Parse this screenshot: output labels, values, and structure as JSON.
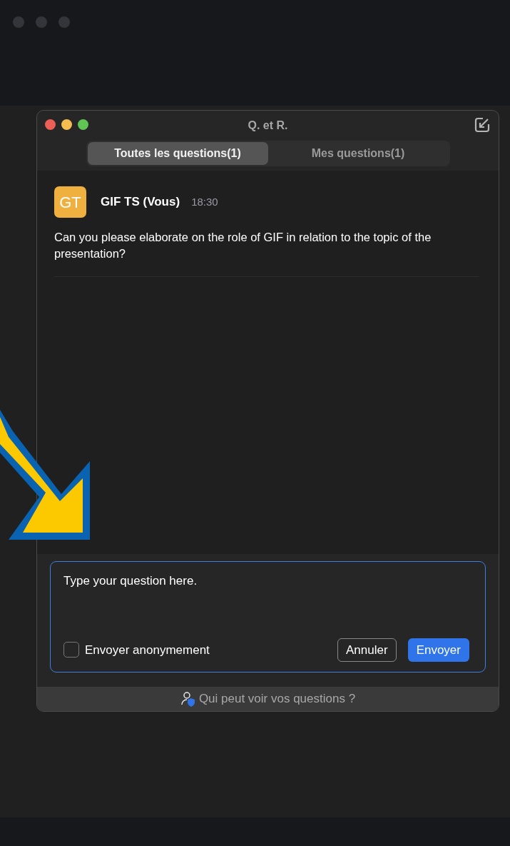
{
  "window": {
    "title": "Q. et R."
  },
  "tabs": [
    {
      "label": "Toutes les questions(1)",
      "selected": true
    },
    {
      "label": "Mes questions(1)",
      "selected": false
    }
  ],
  "questions": [
    {
      "initials": "GT",
      "author": "GIF TS (Vous)",
      "time": "18:30",
      "text": "Can you please elaborate on the role of GIF in relation to the topic of the presentation?"
    }
  ],
  "composer": {
    "value": "Type your question here.",
    "anonymous": {
      "label": "Envoyer anonymement",
      "checked": false
    },
    "cancel": "Annuler",
    "send": "Envoyer"
  },
  "footer": {
    "label": "Qui peut voir vos questions ?"
  }
}
